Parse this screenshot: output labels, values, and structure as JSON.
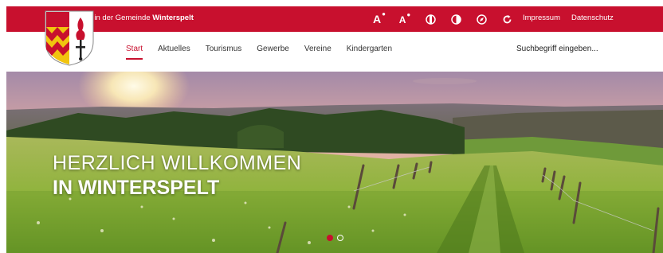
{
  "topbar": {
    "welcome_prefix": "Willkommen in der Gemeinde",
    "welcome_name": "Winterspelt",
    "tools": [
      {
        "label": "A",
        "icon": "text-size-increase-icon"
      },
      {
        "label": "A",
        "icon": "text-size-decrease-icon"
      },
      {
        "icon": "contrast-half-icon"
      },
      {
        "icon": "contrast-icon"
      },
      {
        "icon": "compass-icon"
      },
      {
        "icon": "reload-icon"
      }
    ],
    "links": [
      "Impressum",
      "Datenschutz"
    ]
  },
  "nav": {
    "items": [
      "Start",
      "Aktuelles",
      "Tourismus",
      "Gewerbe",
      "Vereine",
      "Kindergarten"
    ],
    "active_index": 0
  },
  "search": {
    "placeholder": "Suchbegriff eingeben..."
  },
  "hero": {
    "line1": "HERZLICH WILLKOMMEN",
    "line2": "IN WINTERSPELT",
    "slides": 2,
    "active_slide": 0
  },
  "colors": {
    "brand_red": "#c8102e",
    "crest_yellow": "#f1c40f",
    "white": "#ffffff"
  }
}
